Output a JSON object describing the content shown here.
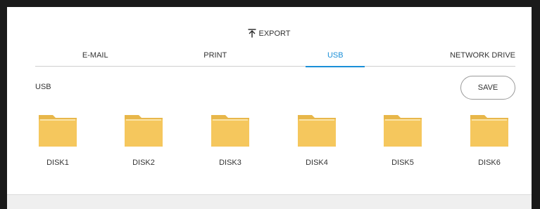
{
  "dialog": {
    "title": "EXPORT",
    "title_icon": "export-upload-icon"
  },
  "tabs": [
    {
      "label": "E-MAIL",
      "active": false
    },
    {
      "label": "PRINT",
      "active": false
    },
    {
      "label": "USB",
      "active": true
    },
    {
      "label": "NETWORK DRIVE",
      "active": false
    }
  ],
  "section": {
    "label": "USB"
  },
  "actions": {
    "save_label": "SAVE"
  },
  "disks": [
    {
      "label": "DISK1",
      "icon": "folder-icon"
    },
    {
      "label": "DISK2",
      "icon": "folder-icon"
    },
    {
      "label": "DISK3",
      "icon": "folder-icon"
    },
    {
      "label": "DISK4",
      "icon": "folder-icon"
    },
    {
      "label": "DISK5",
      "icon": "folder-icon"
    },
    {
      "label": "DISK6",
      "icon": "folder-icon"
    }
  ],
  "colors": {
    "accent": "#1a8fd8",
    "folder": "#f5c75d",
    "folder_tab": "#e8b74a",
    "panel_bg": "#ffffff",
    "frame_bg": "#1a1a1a",
    "footer_bg": "#efefef"
  }
}
